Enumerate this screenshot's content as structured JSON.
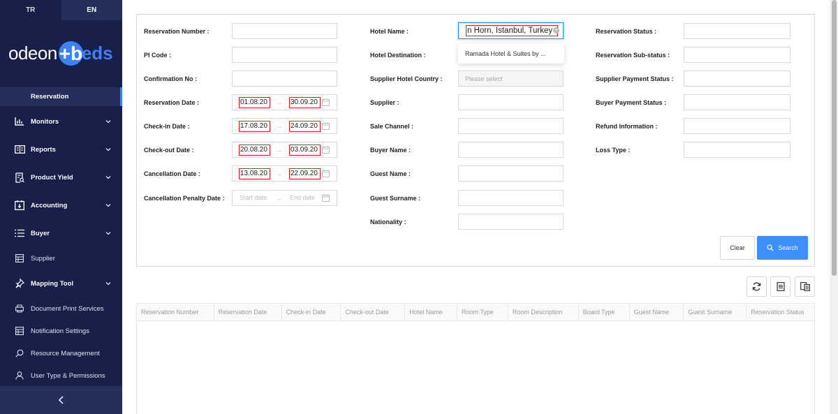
{
  "lang": {
    "tr": "TR",
    "en": "EN"
  },
  "logo": {
    "odeon": "odeon",
    "plus": "+",
    "b": "b",
    "eds": "eds"
  },
  "sidebar": {
    "items": [
      {
        "label": "Reservation"
      },
      {
        "label": "Monitors"
      },
      {
        "label": "Reports"
      },
      {
        "label": "Product Yield"
      },
      {
        "label": "Accounting"
      },
      {
        "label": "Buyer"
      },
      {
        "label": "Supplier"
      },
      {
        "label": "Mapping Tool"
      },
      {
        "label": "Document Print Services"
      },
      {
        "label": "Notification Settings"
      },
      {
        "label": "Resource Management"
      },
      {
        "label": "User Type & Permissions"
      }
    ]
  },
  "form": {
    "reservation_number": "Reservation Number :",
    "pi_code": "PI Code :",
    "confirmation_no": "Confirmation No :",
    "reservation_date": {
      "label": "Reservation Date :",
      "start": "01.08.20",
      "end": "30.09.20"
    },
    "checkin_date": {
      "label": "Check-in Date :",
      "start": "17.08.20",
      "end": "24.09.20"
    },
    "checkout_date": {
      "label": "Check-out Date :",
      "start": "20.08.20",
      "end": "03.09.20"
    },
    "cancellation_date": {
      "label": "Cancellation Date :",
      "start": "13.08.20",
      "end": "22.09.20"
    },
    "cancellation_penalty_date": {
      "label": "Cancellation Penalty Date :",
      "start_placeholder": "Start date",
      "end_placeholder": "End date"
    },
    "hotel_name": {
      "label": "Hotel Name :",
      "value": "n Horn, Istanbul, Turkey"
    },
    "hotel_destination": "Hotel Destination :",
    "supplier_hotel_country": {
      "label": "Supplier Hotel Country :",
      "placeholder": "Please select"
    },
    "supplier": "Supplier :",
    "sale_channel": "Sale Channel :",
    "buyer_name": "Buyer Name :",
    "guest_name": "Guest Name :",
    "guest_surname": "Guest Surname :",
    "nationality": "Nationality :",
    "reservation_status": "Reservation Status :",
    "reservation_sub_status": "Reservation Sub-status :",
    "supplier_payment_status": "Supplier Payment Status :",
    "buyer_payment_status": "Buyer Payment Status :",
    "refund_information": "Refund Information :",
    "loss_type": "Loss Type :",
    "dropdown_option": "Ramada Hotel & Suites by ...",
    "date_arrow": "→"
  },
  "buttons": {
    "clear": "Clear",
    "search": "Search"
  },
  "table": {
    "columns": [
      "Reservation Number",
      "Reservation Date",
      "Check-in Date",
      "Check-out Date",
      "Hotel Name",
      "Room Type",
      "Room Description",
      "Board Type",
      "Guest Name",
      "Guest Surname",
      "Reservation Status"
    ]
  },
  "colors": {
    "sidebar": "#18204a",
    "accent": "#3d8fff",
    "highlight": "#e02020"
  }
}
